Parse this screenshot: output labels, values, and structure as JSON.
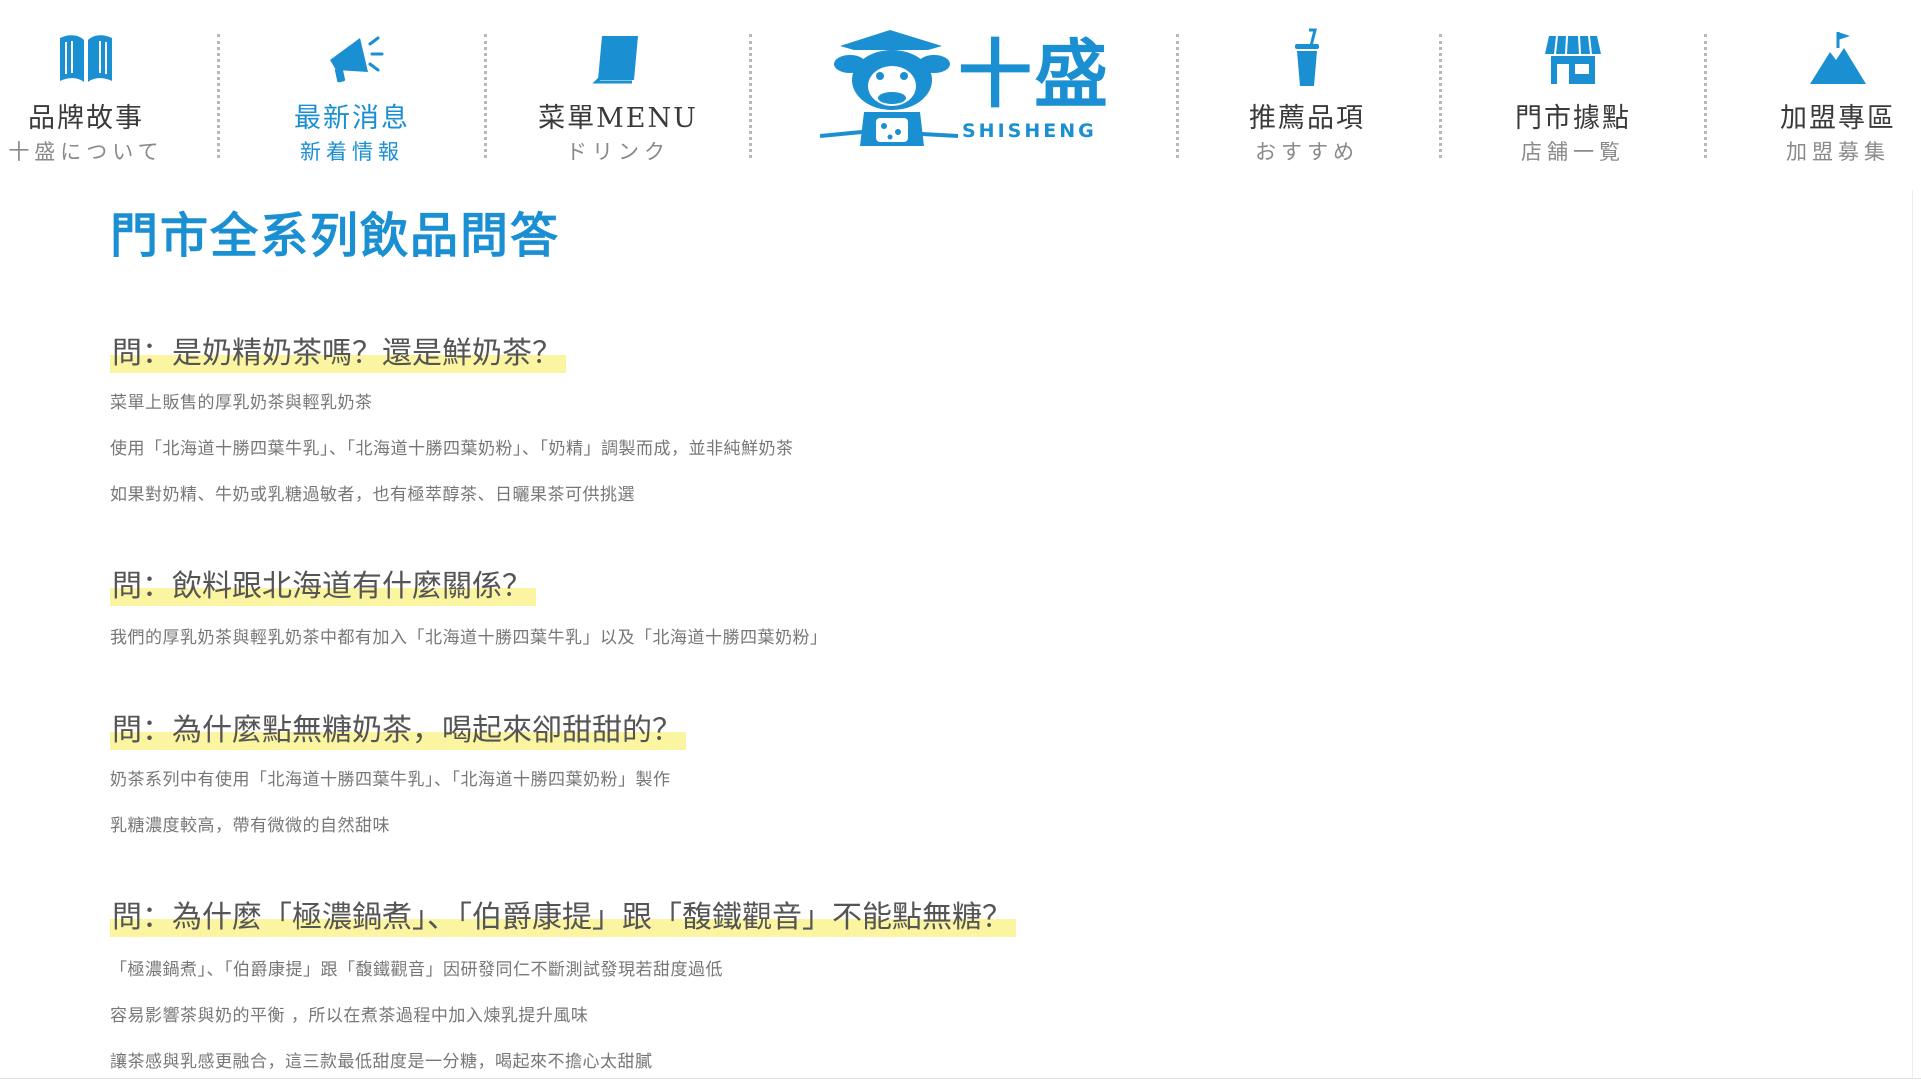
{
  "nav": {
    "items": [
      {
        "zh": "品牌故事",
        "sub": "十盛について",
        "icon": "book-icon"
      },
      {
        "zh": "最新消息",
        "sub": "新着情報",
        "icon": "megaphone-icon"
      },
      {
        "zh": "菜單MENU",
        "sub": "ドリンク",
        "icon": "menu-book-icon"
      },
      {
        "zh": "推薦品項",
        "sub": "おすすめ",
        "icon": "drink-cup-icon"
      },
      {
        "zh": "門市據點",
        "sub": "店舗一覧",
        "icon": "store-icon"
      },
      {
        "zh": "加盟專區",
        "sub": "加盟募集",
        "icon": "mountain-flag-icon"
      }
    ],
    "active_index": 1
  },
  "logo": {
    "brand_cn": "十盛",
    "brand_en": "SHISHENG"
  },
  "colors": {
    "accent": "#1a8fd2",
    "highlight": "#fbf5a1",
    "text": "#555555",
    "muted": "#777777"
  },
  "page": {
    "title": "門市全系列飲品問答"
  },
  "faq": [
    {
      "q": "問：是奶精奶茶嗎？還是鮮奶茶？",
      "a": [
        "菜單上販售的厚乳奶茶與輕乳奶茶",
        "使用「北海道十勝四葉牛乳」、「北海道十勝四葉奶粉」、「奶精」調製而成，並非純鮮奶茶",
        "如果對奶精、牛奶或乳糖過敏者，也有極萃醇茶、日曬果茶可供挑選"
      ]
    },
    {
      "q": "問：飲料跟北海道有什麼關係？",
      "a": [
        "我們的厚乳奶茶與輕乳奶茶中都有加入「北海道十勝四葉牛乳」以及「北海道十勝四葉奶粉」"
      ]
    },
    {
      "q": "問：為什麼點無糖奶茶，喝起來卻甜甜的？",
      "a": [
        "奶茶系列中有使用「北海道十勝四葉牛乳」、「北海道十勝四葉奶粉」製作",
        "乳糖濃度較高，帶有微微的自然甜味"
      ]
    },
    {
      "q": "問：為什麼「極濃鍋煮」、「伯爵康提」跟「馥鐵觀音」不能點無糖？",
      "a": [
        "「極濃鍋煮」、「伯爵康提」跟「馥鐵觀音」因研發同仁不斷測試發現若甜度過低",
        "容易影響茶與奶的平衡 ，所以在煮茶過程中加入煉乳提升風味",
        "讓茶感與乳感更融合，這三款最低甜度是一分糖，喝起來不擔心太甜膩"
      ]
    }
  ]
}
